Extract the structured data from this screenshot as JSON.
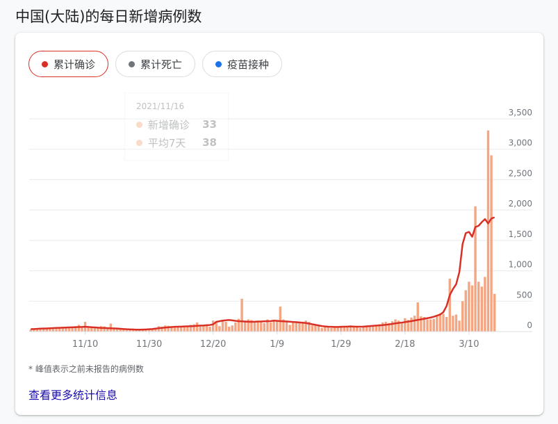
{
  "page": {
    "title": "中国(大陆)的每日新增病例数"
  },
  "tabs": [
    {
      "label": "累计确诊",
      "color": "#d93025",
      "active": true
    },
    {
      "label": "累计死亡",
      "color": "#70757a",
      "active": false
    },
    {
      "label": "疫苗接种",
      "color": "#1a73e8",
      "active": false
    }
  ],
  "tooltip": {
    "date": "2021/11/16",
    "rows": [
      {
        "label": "新增确诊",
        "value": "33"
      },
      {
        "label": "平均7天",
        "value": "38"
      }
    ]
  },
  "chart_data": {
    "type": "bar",
    "bar_color": "#f4a582",
    "line_color": "#d93025",
    "y_ticks": [
      "3,500",
      "3,000",
      "2,500",
      "2,000",
      "1,500",
      "1,000",
      "500",
      "0"
    ],
    "ylim": [
      0,
      3500
    ],
    "grid": true,
    "x_ticks": [
      "11/10",
      "11/30",
      "12/20",
      "1/9",
      "1/29",
      "2/18",
      "3/10"
    ],
    "x_tick_index": [
      17,
      37,
      57,
      77,
      97,
      117,
      137
    ],
    "series": [
      {
        "name": "新增确诊",
        "kind": "bar",
        "values": [
          35,
          40,
          30,
          45,
          50,
          40,
          55,
          60,
          45,
          70,
          65,
          75,
          60,
          80,
          90,
          110,
          85,
          160,
          70,
          60,
          80,
          75,
          90,
          85,
          70,
          130,
          65,
          50,
          35,
          30,
          25,
          30,
          35,
          30,
          25,
          35,
          40,
          45,
          50,
          60,
          90,
          80,
          100,
          95,
          85,
          90,
          80,
          75,
          85,
          100,
          110,
          120,
          150,
          90,
          105,
          110,
          80,
          180,
          150,
          90,
          170,
          160,
          80,
          100,
          150,
          210,
          540,
          180,
          200,
          190,
          160,
          180,
          170,
          140,
          200,
          150,
          170,
          190,
          410,
          200,
          180,
          110,
          160,
          170,
          150,
          140,
          180,
          160,
          100,
          120,
          90,
          60,
          80,
          70,
          60,
          85,
          70,
          90,
          80,
          70,
          100,
          90,
          80,
          60,
          70,
          80,
          90,
          100,
          110,
          120,
          150,
          160,
          140,
          170,
          200,
          180,
          150,
          220,
          190,
          230,
          260,
          480,
          250,
          240,
          200,
          200,
          210,
          250,
          300,
          290,
          240,
          870,
          260,
          280,
          180,
          500,
          680,
          820,
          760,
          2060,
          820,
          740,
          900,
          3310,
          2900,
          620
        ]
      },
      {
        "name": "平均7天",
        "kind": "line",
        "values": [
          40,
          42,
          45,
          48,
          50,
          52,
          55,
          57,
          60,
          62,
          64,
          66,
          68,
          70,
          72,
          74,
          76,
          78,
          76,
          72,
          68,
          64,
          60,
          58,
          56,
          54,
          52,
          50,
          46,
          42,
          38,
          36,
          34,
          32,
          32,
          33,
          35,
          38,
          42,
          48,
          55,
          60,
          66,
          70,
          74,
          78,
          80,
          82,
          84,
          86,
          88,
          90,
          94,
          98,
          100,
          104,
          108,
          118,
          160,
          170,
          180,
          186,
          190,
          184,
          176,
          170,
          168,
          165,
          162,
          160,
          162,
          164,
          166,
          168,
          170,
          172,
          180,
          176,
          172,
          168,
          166,
          162,
          158,
          154,
          150,
          146,
          140,
          130,
          120,
          110,
          100,
          90,
          84,
          80,
          78,
          76,
          76,
          78,
          80,
          82,
          84,
          82,
          80,
          80,
          82,
          86,
          90,
          94,
          98,
          102,
          106,
          112,
          118,
          126,
          134,
          142,
          148,
          156,
          164,
          172,
          182,
          192,
          200,
          210,
          220,
          230,
          244,
          262,
          280,
          320,
          420,
          600,
          700,
          780,
          980,
          1440,
          1620,
          1640,
          1560,
          1720,
          1740,
          1800,
          1850,
          1780,
          1860,
          1880
        ]
      }
    ]
  },
  "footnote": "* 峰值表示之前未报告的病例数",
  "more_link": "查看更多统计信息"
}
